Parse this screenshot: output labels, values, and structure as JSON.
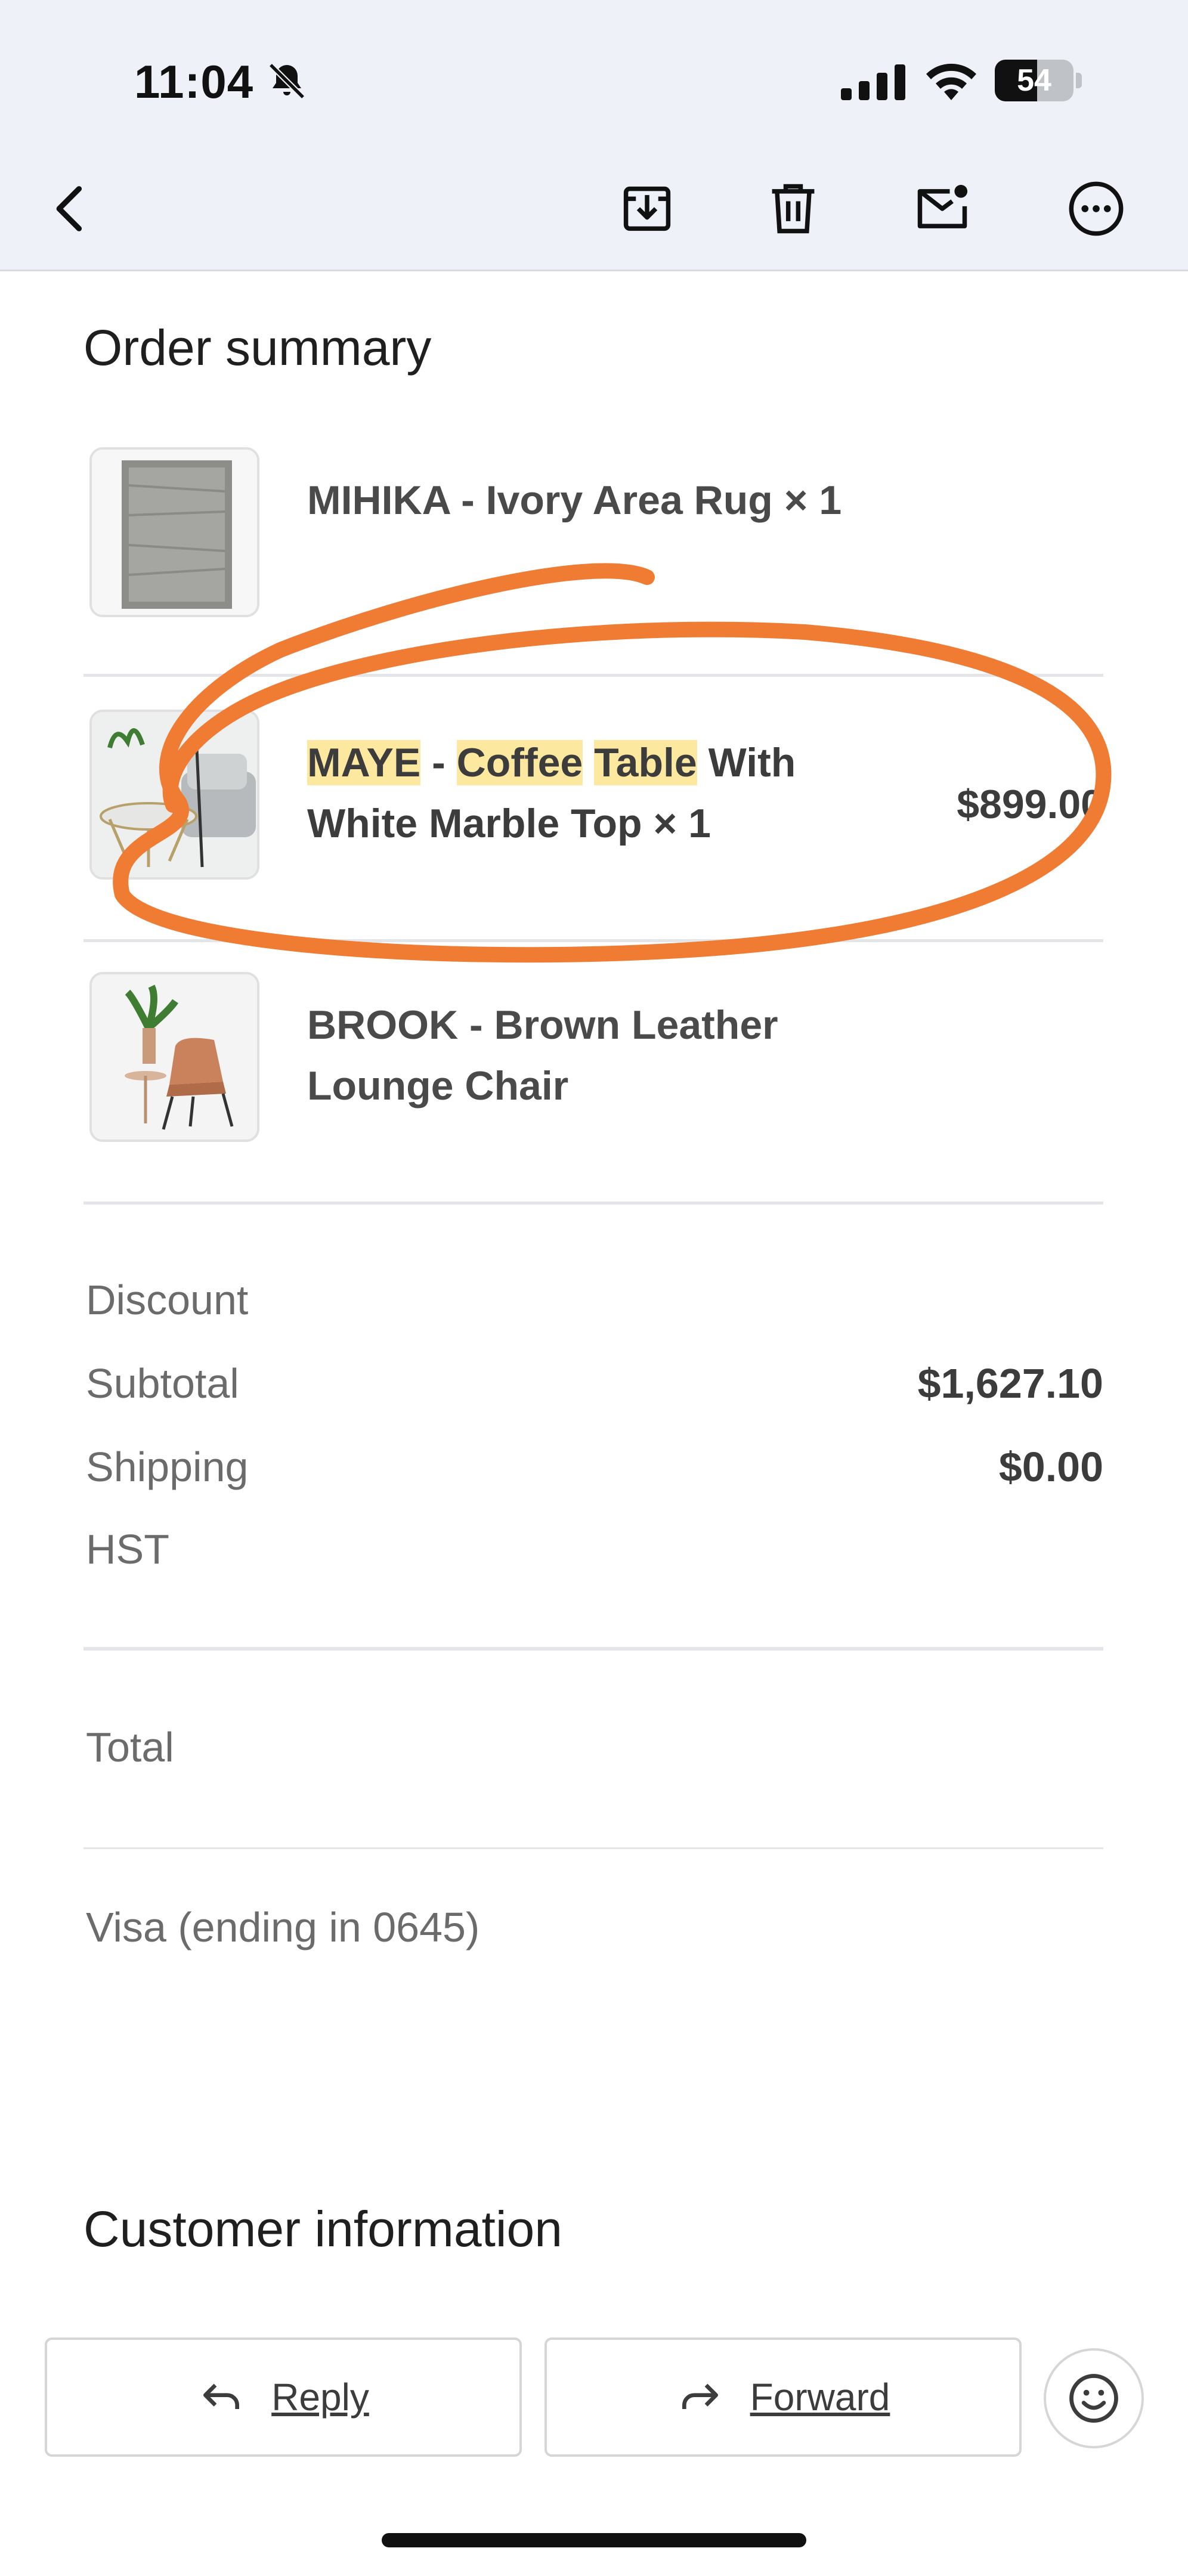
{
  "status_bar": {
    "time": "11:04",
    "battery_level": "54",
    "battery_fraction": 0.54
  },
  "toolbar": {
    "icons": [
      "back-icon",
      "archive-icon",
      "trash-icon",
      "mark-unread-icon",
      "more-icon"
    ]
  },
  "order": {
    "title": "Order summary",
    "items": [
      {
        "name": "MIHIKA - Ivory Area Rug × 1",
        "price": ""
      },
      {
        "name_parts": [
          "MAYE",
          " - ",
          "Coffee",
          " ",
          "Table",
          " With White Marble Top × 1"
        ],
        "price": "$899.00"
      },
      {
        "name": "BROOK - Brown Leather Lounge Chair",
        "price": ""
      }
    ]
  },
  "totals": {
    "discount_label": "Discount",
    "discount_value": "",
    "subtotal_label": "Subtotal",
    "subtotal_value": "$1,627.10",
    "shipping_label": "Shipping",
    "shipping_value": "$0.00",
    "hst_label": "HST",
    "hst_value": "",
    "total_label": "Total",
    "total_value": "",
    "payment_label": "Visa (ending in 0645)",
    "payment_value": ""
  },
  "customer": {
    "title": "Customer information"
  },
  "actions": {
    "reply_label": "Reply",
    "forward_label": "Forward"
  },
  "colors": {
    "annotation": "#f07b32",
    "highlight": "#fde8a0",
    "toolbar_bg": "#eef2f8"
  }
}
